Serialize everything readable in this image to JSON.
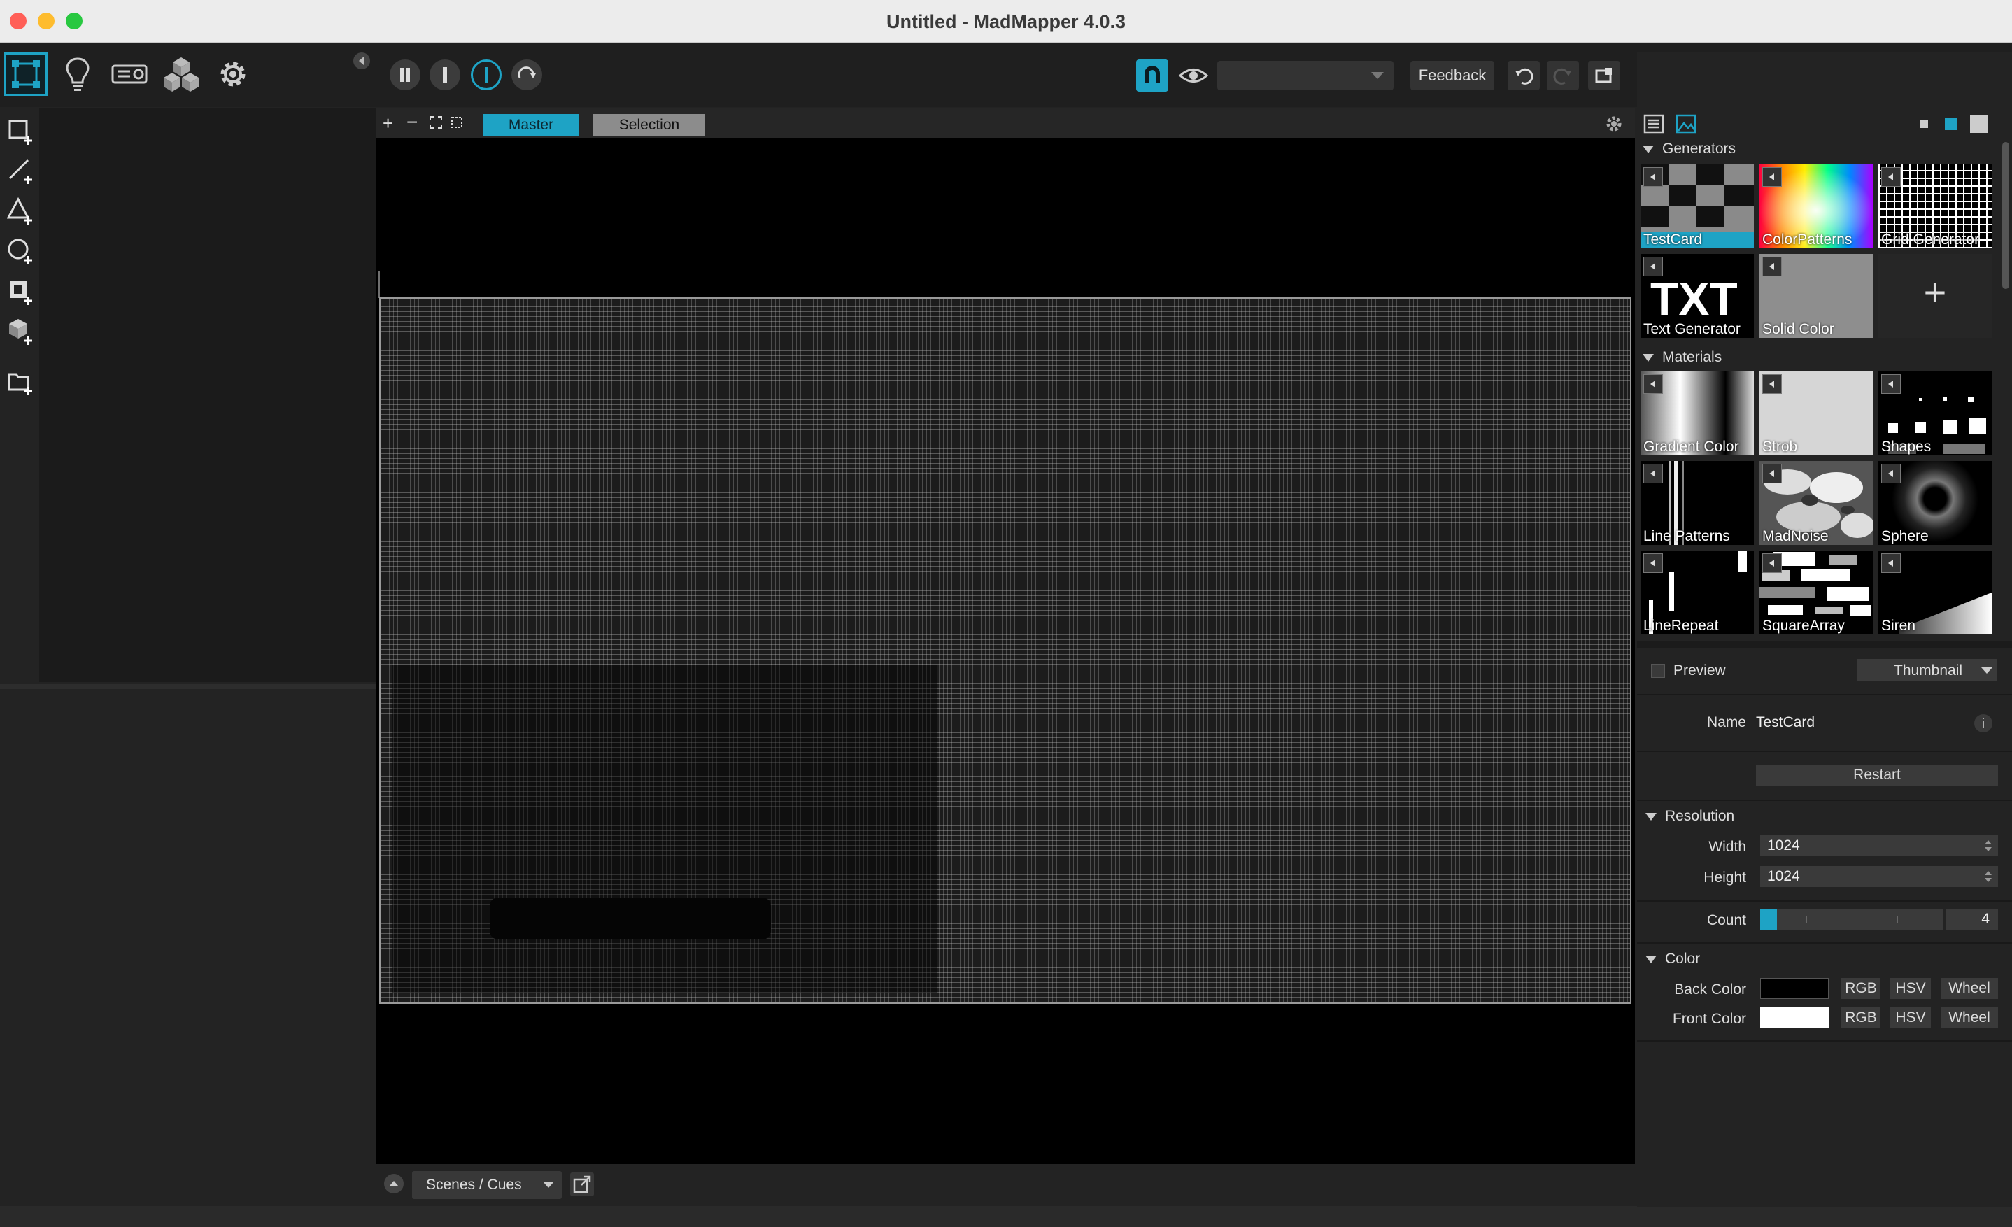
{
  "window": {
    "title": "Untitled - MadMapper 4.0.3"
  },
  "toolbar": {
    "modes": [
      {
        "icon": "surface-mode-icon",
        "active": true
      },
      {
        "icon": "lightbulb-icon",
        "active": false
      },
      {
        "icon": "projector-icon",
        "active": false
      },
      {
        "icon": "cubes-icon",
        "active": false
      },
      {
        "icon": "gear-icon",
        "active": false
      }
    ],
    "transport": [
      "pause-icon",
      "stop-icon",
      "power-icon",
      "redo-icon"
    ],
    "feedback_label": "Feedback",
    "output_dropdown_value": ""
  },
  "canvas": {
    "tabs": {
      "master": "Master",
      "selection": "Selection"
    },
    "bottom": {
      "scenes_label": "Scenes / Cues"
    }
  },
  "library": {
    "generators_title": "Generators",
    "generators": [
      {
        "label": "TestCard",
        "selected": true
      },
      {
        "label": "ColorPatterns"
      },
      {
        "label": "Grid Generator"
      },
      {
        "label": "Text Generator"
      },
      {
        "label": "Solid Color"
      }
    ],
    "add_label": "+",
    "txt_thumb": "TXT",
    "materials_title": "Materials",
    "materials": [
      {
        "label": "Gradient Color"
      },
      {
        "label": "Strob"
      },
      {
        "label": "Shapes"
      },
      {
        "label": "Line Patterns"
      },
      {
        "label": "MadNoise"
      },
      {
        "label": "Sphere"
      },
      {
        "label": "LineRepeat"
      },
      {
        "label": "SquareArray"
      },
      {
        "label": "Siren"
      }
    ]
  },
  "inspector": {
    "preview_label": "Preview",
    "preview_mode": "Thumbnail",
    "name_label": "Name",
    "name_value": "TestCard",
    "restart_label": "Restart",
    "resolution_title": "Resolution",
    "width_label": "Width",
    "width_value": "1024",
    "height_label": "Height",
    "height_value": "1024",
    "count_label": "Count",
    "count_value": "4",
    "color_title": "Color",
    "back_color_label": "Back Color",
    "front_color_label": "Front Color",
    "rgb_label": "RGB",
    "hsv_label": "HSV",
    "wheel_label": "Wheel",
    "colors": {
      "back": "#000000",
      "front": "#ffffff",
      "accent": "#1ea3c5"
    }
  }
}
